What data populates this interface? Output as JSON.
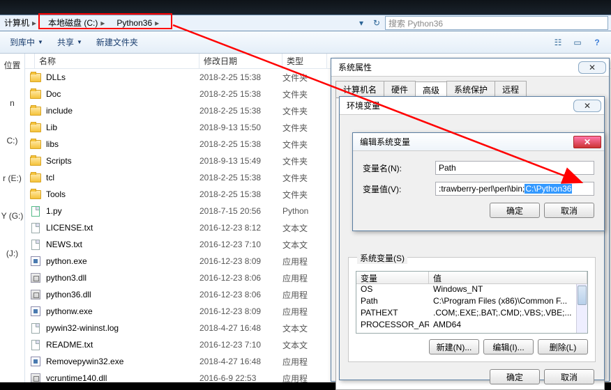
{
  "breadcrumb": {
    "root": "计算机",
    "drive": "本地磁盘 (C:)",
    "folder": "Python36"
  },
  "search": {
    "placeholder": "搜索 Python36"
  },
  "toolbar": {
    "include": "到库中",
    "share": "共享",
    "newfolder": "新建文件夹"
  },
  "side": {
    "loc": "位置",
    "n": "n",
    "c": "C:)",
    "e": "r (E:)",
    "y": "Y (G:)",
    "j": "(J:)"
  },
  "cols": {
    "name": "名称",
    "date": "修改日期",
    "type": "类型"
  },
  "files": [
    {
      "icon": "folder",
      "name": "DLLs",
      "date": "2018-2-25 15:38",
      "type": "文件夹"
    },
    {
      "icon": "folder",
      "name": "Doc",
      "date": "2018-2-25 15:38",
      "type": "文件夹"
    },
    {
      "icon": "folder",
      "name": "include",
      "date": "2018-2-25 15:38",
      "type": "文件夹"
    },
    {
      "icon": "folder",
      "name": "Lib",
      "date": "2018-9-13 15:50",
      "type": "文件夹"
    },
    {
      "icon": "folder",
      "name": "libs",
      "date": "2018-2-25 15:38",
      "type": "文件夹"
    },
    {
      "icon": "folder",
      "name": "Scripts",
      "date": "2018-9-13 15:49",
      "type": "文件夹"
    },
    {
      "icon": "folder",
      "name": "tcl",
      "date": "2018-2-25 15:38",
      "type": "文件夹"
    },
    {
      "icon": "folder",
      "name": "Tools",
      "date": "2018-2-25 15:38",
      "type": "文件夹"
    },
    {
      "icon": "py",
      "name": "1.py",
      "date": "2018-7-15 20:56",
      "type": "Python"
    },
    {
      "icon": "file",
      "name": "LICENSE.txt",
      "date": "2016-12-23 8:12",
      "type": "文本文"
    },
    {
      "icon": "file",
      "name": "NEWS.txt",
      "date": "2016-12-23 7:10",
      "type": "文本文"
    },
    {
      "icon": "exe",
      "name": "python.exe",
      "date": "2016-12-23 8:09",
      "type": "应用程"
    },
    {
      "icon": "dll",
      "name": "python3.dll",
      "date": "2016-12-23 8:06",
      "type": "应用程"
    },
    {
      "icon": "dll",
      "name": "python36.dll",
      "date": "2016-12-23 8:06",
      "type": "应用程"
    },
    {
      "icon": "exe",
      "name": "pythonw.exe",
      "date": "2016-12-23 8:09",
      "type": "应用程"
    },
    {
      "icon": "file",
      "name": "pywin32-wininst.log",
      "date": "2018-4-27 16:48",
      "type": "文本文"
    },
    {
      "icon": "file",
      "name": "README.txt",
      "date": "2016-12-23 7:10",
      "type": "文本文"
    },
    {
      "icon": "exe",
      "name": "Removepywin32.exe",
      "date": "2018-4-27 16:48",
      "type": "应用程"
    },
    {
      "icon": "dll",
      "name": "vcruntime140.dll",
      "date": "2016-6-9 22:53",
      "type": "应用程"
    }
  ],
  "sysprop": {
    "title": "系统属性",
    "tabs": [
      "计算机名",
      "硬件",
      "高级",
      "系统保护",
      "远程"
    ],
    "active": 2
  },
  "envvar": {
    "title": "环境变量",
    "sysvars_label": "系统变量(S)",
    "hdr_var": "变量",
    "hdr_val": "值",
    "sysvars": [
      {
        "k": "OS",
        "v": "Windows_NT"
      },
      {
        "k": "Path",
        "v": "C:\\Program Files (x86)\\Common F..."
      },
      {
        "k": "PATHEXT",
        "v": ".COM;.EXE;.BAT;.CMD;.VBS;.VBE;..."
      },
      {
        "k": "PROCESSOR_AR",
        "v": "AMD64"
      }
    ],
    "btn_new": "新建(N)...",
    "btn_edit": "编辑(I)...",
    "btn_del": "删除(L)",
    "btn_ok": "确定",
    "btn_cancel": "取消"
  },
  "editdlg": {
    "title": "编辑系统变量",
    "name_lbl": "变量名(N):",
    "name_val": "Path",
    "val_lbl": "变量值(V):",
    "val_prefix": ":trawberry-perl\\perl\\bin;",
    "val_sel": "C:\\Python36",
    "btn_ok": "确定",
    "btn_cancel": "取消"
  }
}
